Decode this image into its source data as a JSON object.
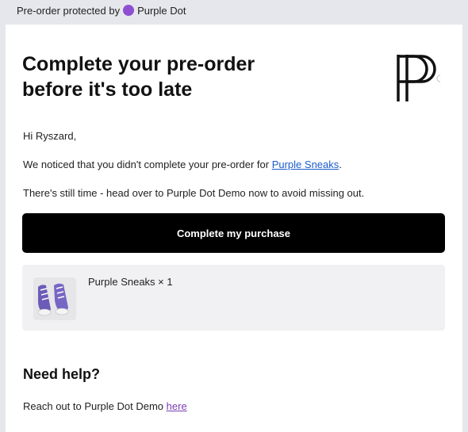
{
  "banner": {
    "prefix": "Pre-order protected by",
    "brand": "Purple Dot",
    "dot_color": "#8e4fd1"
  },
  "email": {
    "headline": "Complete your pre-order before it's too late",
    "logo_icon": "purple-dot-pp-logo",
    "greeting": "Hi Ryszard,",
    "notice_prefix": "We noticed that you didn't complete your pre-order for",
    "notice_link": "Purple Sneaks",
    "notice_suffix": ".",
    "reminder": "There's still time - head over to Purple Dot Demo now to avoid missing out.",
    "cta_label": "Complete my purchase",
    "product": {
      "name": "Purple Sneaks × 1",
      "thumbnail_icon": "sneakers-thumbnail"
    },
    "help": {
      "title": "Need help?",
      "text_prefix": "Reach out to Purple Dot Demo",
      "link_label": "here"
    }
  },
  "colors": {
    "page_bg": "#e6e7ec",
    "cta_bg": "#000000",
    "link": "#1a5ccc",
    "help_link": "#7b3fb5"
  }
}
